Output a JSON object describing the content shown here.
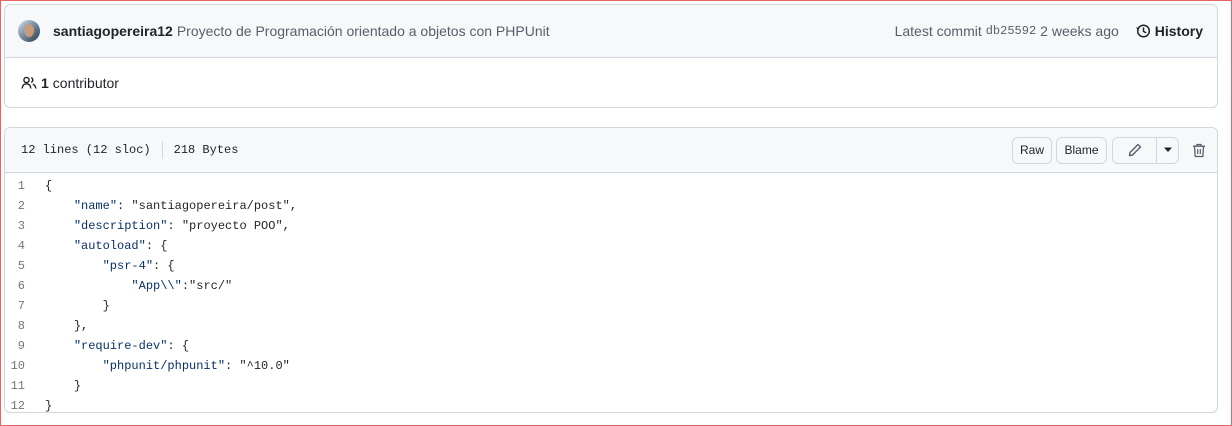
{
  "commit": {
    "author": "santiagopereira12",
    "message": "Proyecto de Programación orientado a objetos con PHPUnit",
    "latest_label": "Latest commit",
    "sha": "db25592",
    "age": "2 weeks ago",
    "history_label": "History",
    "contributors_count": "1",
    "contributors_label": "contributor"
  },
  "file": {
    "lines_info": "12 lines (12 sloc)",
    "size": "218 Bytes",
    "raw_label": "Raw",
    "blame_label": "Blame"
  },
  "code": [
    {
      "n": "1",
      "indent": "",
      "key": "",
      "rest": "{"
    },
    {
      "n": "2",
      "indent": "    ",
      "key": "\"name\"",
      "rest": ": \"santiagopereira/post\","
    },
    {
      "n": "3",
      "indent": "    ",
      "key": "\"description\"",
      "rest": ": \"proyecto POO\","
    },
    {
      "n": "4",
      "indent": "    ",
      "key": "\"autoload\"",
      "rest": ": {"
    },
    {
      "n": "5",
      "indent": "        ",
      "key": "\"psr-4\"",
      "rest": ": {"
    },
    {
      "n": "6",
      "indent": "            ",
      "key": "\"App\\\\\"",
      "rest": ":\"src/\""
    },
    {
      "n": "7",
      "indent": "        ",
      "key": "",
      "rest": "}"
    },
    {
      "n": "8",
      "indent": "    ",
      "key": "",
      "rest": "},"
    },
    {
      "n": "9",
      "indent": "    ",
      "key": "\"require-dev\"",
      "rest": ": {"
    },
    {
      "n": "10",
      "indent": "        ",
      "key": "\"phpunit/phpunit\"",
      "rest": ": \"^10.0\""
    },
    {
      "n": "11",
      "indent": "    ",
      "key": "",
      "rest": "}"
    },
    {
      "n": "12",
      "indent": "",
      "key": "",
      "rest": "}"
    }
  ]
}
